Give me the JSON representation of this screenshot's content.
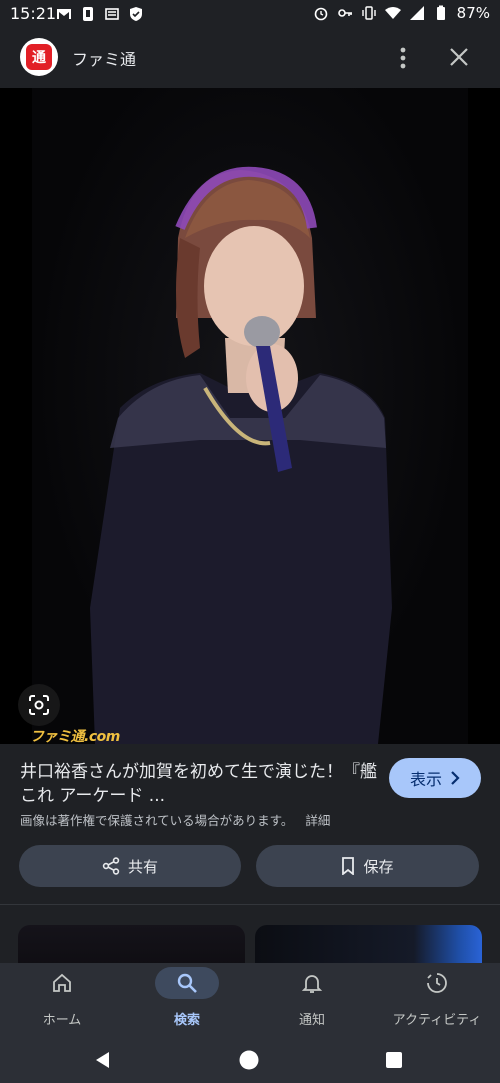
{
  "status_bar": {
    "time": "15:21",
    "battery": "87%"
  },
  "app_bar": {
    "site_logo_text": "通",
    "site_name": "ファミ通"
  },
  "image": {
    "watermark": "ファミ通.com"
  },
  "result": {
    "title": "井口裕香さんが加賀を初めて生で演じた！『艦これ アーケード ...",
    "visit_label": "表示",
    "copyright": "画像は著作権で保護されている場合があります。",
    "copyright_detail": "詳細",
    "share_label": "共有",
    "save_label": "保存"
  },
  "bottom_nav": {
    "items": [
      {
        "label": "ホーム",
        "icon": "home-icon"
      },
      {
        "label": "検索",
        "icon": "search-icon",
        "active": true
      },
      {
        "label": "通知",
        "icon": "bell-icon"
      },
      {
        "label": "アクティビティ",
        "icon": "activity-icon"
      }
    ]
  },
  "colors": {
    "background": "#1f2125",
    "accent": "#a8c7fa",
    "brand_red": "#e21f26",
    "chip": "#3c4350"
  }
}
